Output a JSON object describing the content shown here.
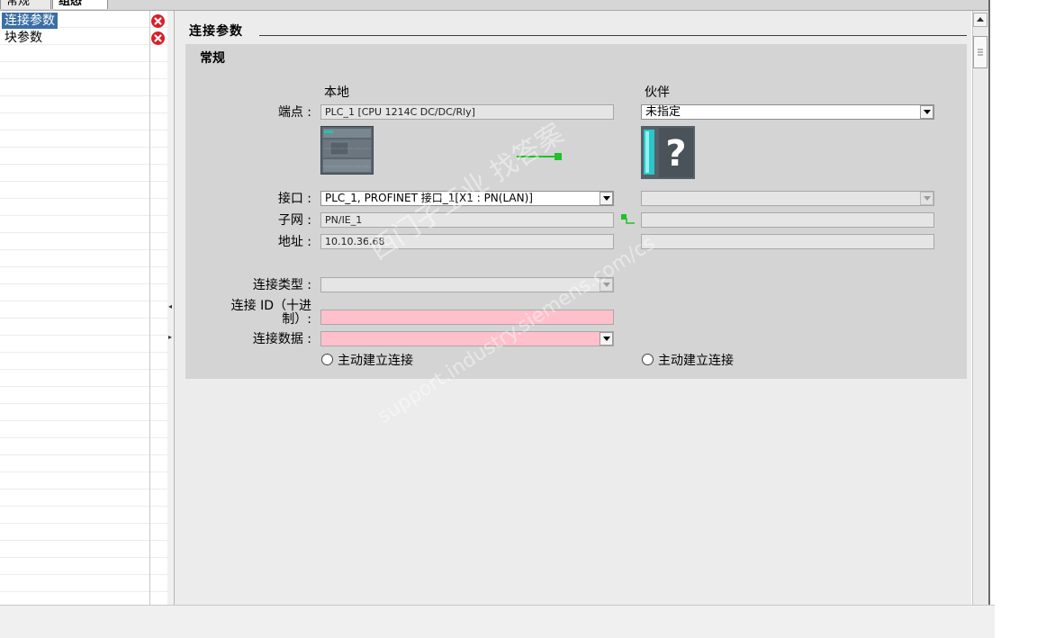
{
  "tabs": [
    {
      "label": "常规",
      "active": false
    },
    {
      "label": "组态",
      "active": true
    }
  ],
  "tree": {
    "items": [
      {
        "label": "连接参数",
        "selected": true,
        "status": "error-icon"
      },
      {
        "label": "块参数",
        "selected": false,
        "status": "error-icon"
      }
    ]
  },
  "section": {
    "title": "连接参数",
    "group_title": "常规"
  },
  "columns": {
    "local": "本地",
    "partner": "伙伴"
  },
  "rows": {
    "endpoint": {
      "label": "端点 :",
      "local_value": "PLC_1 [CPU 1214C DC/DC/Rly]",
      "partner_value": "未指定"
    },
    "interface": {
      "label": "接口 :",
      "local_value": "PLC_1, PROFINET 接口_1[X1 : PN(LAN)]",
      "partner_value": ""
    },
    "subnet": {
      "label": "子网 :",
      "local_value": "PN/IE_1",
      "partner_value": ""
    },
    "address": {
      "label": "地址 :",
      "local_value": "10.10.36.68",
      "partner_value": ""
    },
    "conn_type": {
      "label": "连接类型 :",
      "value": ""
    },
    "conn_id": {
      "label_line1": "连接 ID（十进",
      "label_line2": "制）:",
      "value": ""
    },
    "conn_data": {
      "label": "连接数据 :",
      "value": ""
    }
  },
  "radios": {
    "local": "主动建立连接",
    "partner": "主动建立连接"
  },
  "watermark": {
    "line1": "西门子工业   找答案",
    "line2": "support.industry.siemens.com/cs"
  },
  "colors": {
    "selection": "#3a6ea5",
    "error": "#d71f28",
    "invalid_field": "#ffc0cb",
    "link_green": "#22c02a",
    "group_bg": "#d4d4d4",
    "panel_bg": "#ececec"
  },
  "icons": {
    "tree_status": "error-icon",
    "dropdown": "chevron-down-icon",
    "partner_device": "unknown-device-icon",
    "local_device": "plc-device-icon"
  }
}
